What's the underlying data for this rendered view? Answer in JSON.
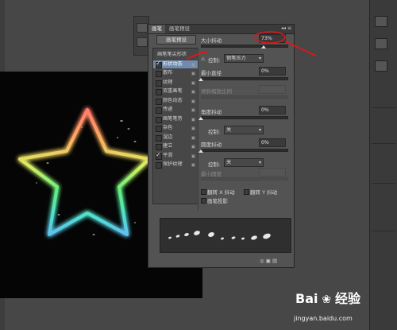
{
  "panel": {
    "tabs": [
      "画笔",
      "画笔预设"
    ],
    "tab_icons": "◂◂ ≡",
    "preset_button": "画笔预设",
    "list": [
      {
        "label": "画笔笔尖形状",
        "checked": null,
        "lock": false,
        "selected": false,
        "header": true
      },
      {
        "label": "形状动态",
        "checked": true,
        "lock": true,
        "selected": true
      },
      {
        "label": "散布",
        "checked": false,
        "lock": true,
        "selected": false
      },
      {
        "label": "纹理",
        "checked": false,
        "lock": true,
        "selected": false
      },
      {
        "label": "双重画笔",
        "checked": false,
        "lock": true,
        "selected": false
      },
      {
        "label": "颜色动态",
        "checked": false,
        "lock": true,
        "selected": false
      },
      {
        "label": "传递",
        "checked": false,
        "lock": true,
        "selected": false
      },
      {
        "label": "画笔笔势",
        "checked": false,
        "lock": true,
        "selected": false
      },
      {
        "label": "杂色",
        "checked": false,
        "lock": true,
        "selected": false
      },
      {
        "label": "湿边",
        "checked": false,
        "lock": true,
        "selected": false
      },
      {
        "label": "建立",
        "checked": false,
        "lock": true,
        "selected": false
      },
      {
        "label": "平滑",
        "checked": true,
        "lock": true,
        "selected": false
      },
      {
        "label": "保护纹理",
        "checked": false,
        "lock": true,
        "selected": false
      }
    ],
    "size_jitter": {
      "label": "大小抖动",
      "value": "73%",
      "fraction": 0.73
    },
    "control1": {
      "label": "控制:",
      "value": "钢笔压力"
    },
    "min_diameter": {
      "label": "最小直径",
      "value": "0%",
      "fraction": 0.0
    },
    "tilt_scale": {
      "label": "倾斜缩放比例"
    },
    "angle_jitter": {
      "label": "角度抖动",
      "value": "0%",
      "fraction": 0.0
    },
    "control2": {
      "label": "控制:",
      "value": "关"
    },
    "roundness_jitter": {
      "label": "圆度抖动",
      "value": "0%",
      "fraction": 0.0
    },
    "control3": {
      "label": "控制:",
      "value": "关"
    },
    "min_roundness": {
      "label": "最小圆度"
    },
    "flip_x": "翻转 X 抖动",
    "flip_y": "翻转 Y 抖动",
    "brush_projection": "画笔投影",
    "bottom_icons": "◎ ▣ ▤"
  },
  "watermark": {
    "brand": "Bai",
    "brand2": "经验",
    "site": "jingyan.baidu.com"
  },
  "colors": {
    "accent_selection": "#6f8bb0",
    "annotation_red": "#e0161b"
  }
}
